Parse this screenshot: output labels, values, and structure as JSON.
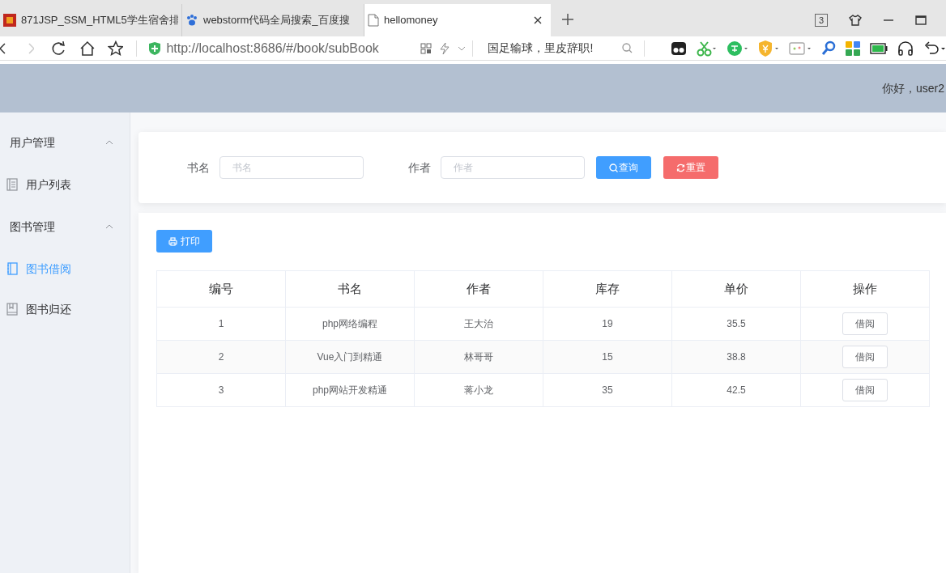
{
  "browser": {
    "tabs": [
      {
        "title": "871JSP_SSM_HTML5学生宿舍排",
        "selected": false,
        "kind": "red"
      },
      {
        "title": "webstorm代码全局搜索_百度搜",
        "selected": false,
        "kind": "paw"
      },
      {
        "title": "hellomoney",
        "selected": true,
        "kind": "page"
      }
    ],
    "tab_count": "3",
    "url": "http://localhost:8686/#/book/subBook",
    "search": "国足输球，里皮辞职!"
  },
  "header": {
    "greeting": "你好，user2"
  },
  "sidebar": [
    {
      "label": "用户管理",
      "expanded": true,
      "children": [
        {
          "label": "用户列表",
          "selected": false,
          "kind": "list"
        }
      ]
    },
    {
      "label": "图书管理",
      "expanded": true,
      "children": [
        {
          "label": "图书借阅",
          "selected": true,
          "kind": "book"
        },
        {
          "label": "图书归还",
          "selected": false,
          "kind": "bookmark"
        }
      ]
    }
  ],
  "filters": [
    {
      "label": "书名",
      "placeholder": "书名"
    },
    {
      "label": "作者",
      "placeholder": "作者"
    }
  ],
  "buttons": [
    {
      "label": "查询",
      "kind": "search"
    },
    {
      "label": "重置",
      "kind": "reset"
    }
  ],
  "print_button": "打印",
  "table": {
    "columns": [
      "编号",
      "书名",
      "作者",
      "库存",
      "单价",
      "操作"
    ],
    "rows": [
      {
        "cells": [
          "1",
          "php网络编程",
          "王大治",
          "19",
          "35.5"
        ],
        "action": "借阅"
      },
      {
        "cells": [
          "2",
          "Vue入门到精通",
          "林哥哥",
          "15",
          "38.8"
        ],
        "action": "借阅"
      },
      {
        "cells": [
          "3",
          "php网站开发精通",
          "蒋小龙",
          "35",
          "42.5"
        ],
        "action": "借阅"
      }
    ]
  }
}
